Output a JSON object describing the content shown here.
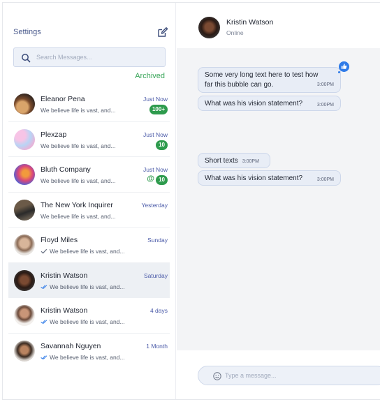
{
  "sidebar": {
    "settings_label": "Settings",
    "search_placeholder": "Search Messages...",
    "archived_label": "Archived",
    "conversations": [
      {
        "name": "Eleanor Pena",
        "time": "Just Now",
        "preview": "We believe life is vast, and...",
        "badge": "100+",
        "mention": "",
        "read": "none"
      },
      {
        "name": "Plexzap",
        "time": "Just Now",
        "preview": "We believe life is vast, and...",
        "badge": "10",
        "mention": "",
        "read": "none"
      },
      {
        "name": "Bluth Company",
        "time": "Just Now",
        "preview": "We believe life is vast, and...",
        "badge": "10",
        "mention": "@",
        "read": "none"
      },
      {
        "name": "The New York Inquirer",
        "time": "Yesterday",
        "preview": "We believe life is vast, and...",
        "badge": "",
        "mention": "",
        "read": "none"
      },
      {
        "name": "Floyd Miles",
        "time": "Sunday",
        "preview": "We believe life is vast, and...",
        "badge": "",
        "mention": "",
        "read": "sent"
      },
      {
        "name": "Kristin Watson",
        "time": "Saturday",
        "preview": "We believe life is vast, and...",
        "badge": "",
        "mention": "",
        "read": "read"
      },
      {
        "name": "Kristin Watson",
        "time": "4 days",
        "preview": "We believe life is vast, and...",
        "badge": "",
        "mention": "",
        "read": "read"
      },
      {
        "name": "Savannah Nguyen",
        "time": "1 Month",
        "preview": "We believe life is vast, and...",
        "badge": "",
        "mention": "",
        "read": "read"
      }
    ]
  },
  "chat": {
    "contact_name": "Kristin Watson",
    "contact_status": "Online",
    "messages": [
      {
        "text": "Some very long text here to test how far this bubble can go.",
        "time": "3:00PM"
      },
      {
        "text": "What was his vision statement?",
        "time": "3:00PM"
      },
      {
        "text": "Short texts",
        "time": "3:00PM"
      },
      {
        "text": "What was his vision statement?",
        "time": "3:00PM"
      }
    ],
    "input_placeholder": "Type a message..."
  },
  "colors": {
    "accent_green": "#2e9b4d",
    "accent_blue": "#2f7be8",
    "bubble_bg": "#e8edf6"
  }
}
